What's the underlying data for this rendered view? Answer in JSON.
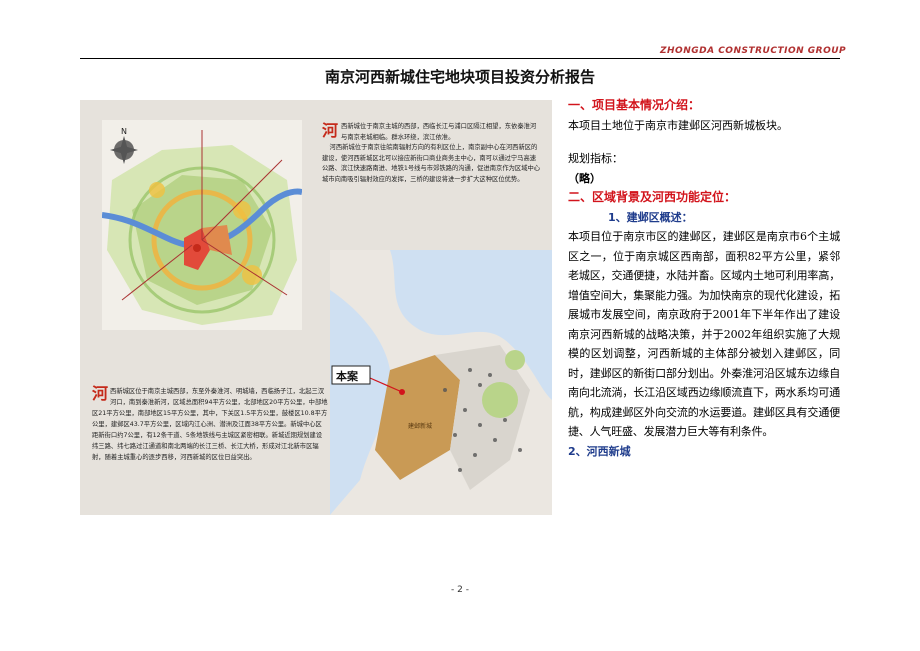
{
  "header": {
    "company": "ZHONGDA  CONSTRUCTION  GROUP",
    "title": "南京河西新城住宅地块项目投资分析报告"
  },
  "figure": {
    "compass_label": "N",
    "top_first_char": "河",
    "top_text_1": "西新城位于南京主城的西部，西临长江与浦口区隔江相望，东依秦淮河与南京老城相临。群水环绕，滨江依准。",
    "top_text_2": "河西新城位于南京往皖南辐射方向的有利区位上，南京副中心在河西新区的建设，使河西新城区北可以接应新街口商业商务主中心，南可以通过宁马高速公路、滨江快速路南进、地铁1号线与市郊铁路的沟通，促进南京作为区域中心城市向南吸引辐射效应的发挥，三桥的建设将进一步扩大这种区位优势。",
    "bottom_first_char": "河",
    "bottom_text": "西新城区位于南京主城西部，东至外秦淮河、明城墙，西临扬子江，北起三汊河口，南到秦淮新河，区域总面积94平方公里，北部地区20平方公里，中部地区21平方公里，南部地区15平方公里，其中，下关区1.5平方公里，鼓楼区10.8平方公里，建邺区43.7平方公里，区域内江心洲、潜洲及江面38平方公里。新城中心区距新街口约7公里，有12条干道、5条地铁线与主城区紧密相联。新城近期规划建设纬三路、纬七路过江通道和南北两端的长江三桥、长江大桥，形成对江北新市区辐射，随着主城重心的逐步西移，河西新城的区位日益突出。",
    "project_label": "本案",
    "zone_label": "建邺新城",
    "colors": {
      "accent_red": "#d2141c",
      "heading_blue": "#1f3c8c"
    }
  },
  "content": {
    "section1_heading": "一、项目基本情况介绍：",
    "section1_text": "本项目土地位于南京市建邺区河西新城板块。",
    "planning_label": "规划指标：",
    "planning_value": "（略）",
    "section2_heading": "二、区域背景及河西功能定位：",
    "sub1_heading": "1、建邺区概述：",
    "sub1_text": "本项目位于南京市区的建邺区，建邺区是南京市6个主城区之一，位于南京城区西南部，面积82平方公里，紧邻老城区，交通便捷，水陆并畜。区域内土地可利用率高，增值空间大，集聚能力强。为加快南京的现代化建设，拓展城市发展空间，南京政府于2001年下半年作出了建设南京河西新城的战略决策，并于2002年组织实施了大规模的区划调整，河西新城的主体部分被划入建邺区，同时，建邺区的新街口部分划出。外秦淮河沿区城东边缘自南向北流淌，长江沿区域西边缘顺流直下，两水系均可通航，构成建邺区外向交流的水运要道。建邺区具有交通便捷、人气旺盛、发展潜力巨大等有利条件。",
    "sub2_heading": "2、河西新城"
  },
  "footer": {
    "page_number": "- 2 -"
  }
}
